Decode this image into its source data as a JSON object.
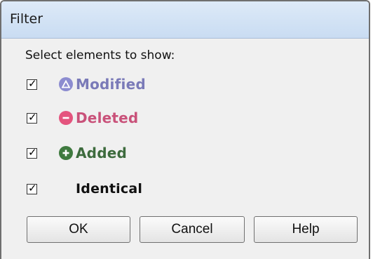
{
  "dialog": {
    "title": "Filter",
    "prompt": "Select elements to show:"
  },
  "items": [
    {
      "label": "Modified",
      "checked": true,
      "icon": "modified-icon",
      "color": "#7a7ab8",
      "icon_color": "#8c8cd0"
    },
    {
      "label": "Deleted",
      "checked": true,
      "icon": "deleted-icon",
      "color": "#c9527a",
      "icon_color": "#e4547e"
    },
    {
      "label": "Added",
      "checked": true,
      "icon": "added-icon",
      "color": "#3d6b3d",
      "icon_color": "#3f7a3f"
    },
    {
      "label": "Identical",
      "checked": true,
      "icon": null,
      "color": "#111111"
    }
  ],
  "buttons": {
    "ok": "OK",
    "cancel": "Cancel",
    "help": "Help"
  }
}
